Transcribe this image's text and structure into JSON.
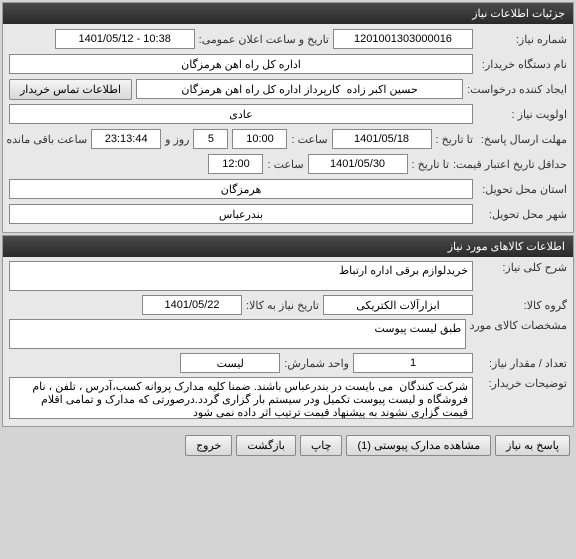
{
  "header1": "جزئیات اطلاعات نیاز",
  "needNo": {
    "label": "شماره نیاز:",
    "value": "1201001303000016"
  },
  "announceDate": {
    "label": "تاریخ و ساعت اعلان عمومی:",
    "value": "1401/05/12 - 10:38"
  },
  "buyerOrg": {
    "label": "نام دستگاه خریدار:",
    "value": "اداره کل راه اهن هرمزگان"
  },
  "requester": {
    "label": "ایجاد کننده درخواست:",
    "value": "حسین اکبر زاده  کارپرداز اداره کل راه اهن هرمزگان"
  },
  "contactBtn": "اطلاعات تماس خریدار",
  "priority": {
    "label": "اولویت نیاز :",
    "value": "عادی"
  },
  "replyDeadline": {
    "label": "مهلت ارسال پاسخ:",
    "toLabel": "تا تاریخ :",
    "date": "1401/05/18",
    "timeLabel": "ساعت :",
    "time": "10:00",
    "daysVal": "5",
    "daysSuffix": "روز و",
    "remain": "23:13:44",
    "remainSuffix": "ساعت باقی مانده"
  },
  "validDeadline": {
    "label": "حداقل تاریخ اعتبار قیمت:",
    "toLabel": "تا تاریخ :",
    "date": "1401/05/30",
    "timeLabel": "ساعت :",
    "time": "12:00"
  },
  "deliveryProvince": {
    "label": "استان محل تحویل:",
    "value": "هرمزگان"
  },
  "deliveryCity": {
    "label": "شهر محل تحویل:",
    "value": "بندرعباس"
  },
  "header2": "اطلاعات کالاهای مورد نیاز",
  "desc": {
    "label": "شرح کلی نیاز:",
    "value": "خریدلوازم برقی اداره ارتباط"
  },
  "goodsGroup": {
    "label": "گروه کالا:",
    "value": "ابزارآلات الکتریکی"
  },
  "needDate": {
    "label": "تاریخ نیاز به کالا:",
    "value": "1401/05/22"
  },
  "goodsSpec": {
    "label": "مشخصات کالای مورد نیاز:",
    "value": "طبق لیست پیوست"
  },
  "qty": {
    "label": "تعداد / مقدار نیاز:",
    "value": "1"
  },
  "unit": {
    "label": "واحد شمارش:",
    "value": "لیست"
  },
  "buyerNotes": {
    "label": "توضیحات خریدار:",
    "value": "شرکت کنندگان  می بایست در بندرعباس باشند. ضمنا کلیه مدارک پروانه کسب،آدرس ، تلفن ، نام فروشگاه و لیست پیوست تکمیل ودر سیستم بار گزاری گردد.درصورتی که مدارک و تمامی اقلام قیمت گزاری نشوند به پیشنهاد قیمت ترتیب اثر داده نمی شود"
  },
  "footer": {
    "reply": "پاسخ به نیاز",
    "attachments": "مشاهده مدارک پیوستی (1)",
    "print": "چاپ",
    "back": "بازگشت",
    "exit": "خروج"
  }
}
